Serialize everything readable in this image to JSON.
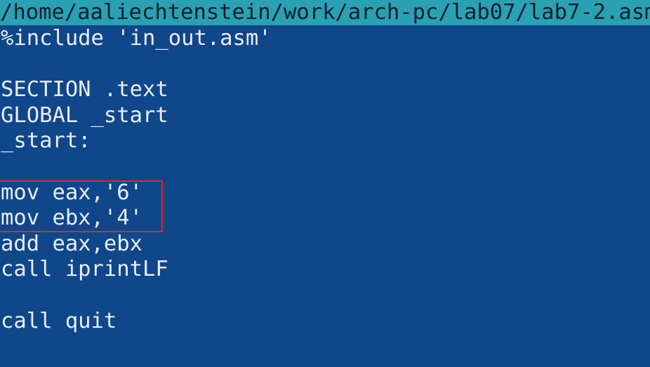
{
  "editor": {
    "file_path": "/home/aaliechtenstein/work/arch-pc/lab07/lab7-2.asm",
    "lines": [
      "%include 'in_out.asm'",
      "",
      "SECTION .text",
      "GLOBAL _start",
      "_start:",
      "",
      "mov eax,'6'",
      "mov ebx,'4'",
      "add eax,ebx",
      "call iprintLF",
      "",
      "call quit"
    ],
    "highlight_color": "#e0282e",
    "background_color": "#10468a",
    "title_bar_color": "#2aa1b3"
  }
}
